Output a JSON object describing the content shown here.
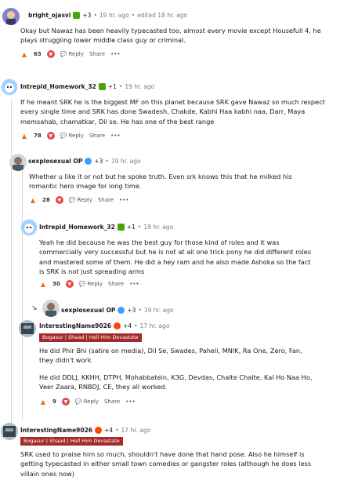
{
  "comments": [
    {
      "user": "bright_ojasvi",
      "flair_count": "+3",
      "time": "19 hr. ago",
      "edited": "edited 18 hr. ago",
      "body": "Okay but Nawaz has been heavily typecasted too, almost every movie except Housefull 4, he plays struggling lower middle class guy or criminal.",
      "score": "63",
      "reply": "Reply",
      "share": "Share",
      "more": "•••"
    },
    {
      "user": "Intrepid_Homework_32",
      "flair_count": "+1",
      "time": "19 hr. ago",
      "body": "If he meant SRK he is the biggest MF on this planet because SRK gave Nawaz so much respect every single time and SRK has done Swadesh, Chakde, Kabhi Haa kabhi naa, Darr, Maya memsahab, chamatkar, Dil se. He has one of the best range",
      "score": "78",
      "reply": "Reply",
      "share": "Share",
      "more": "•••"
    },
    {
      "user": "sexplosexual OP",
      "flair_count": "+3",
      "time": "19 hr. ago",
      "body": "Whether u like it or not but he spoke truth. Even srk knows this that he milked his romantic hero image for long time.",
      "score": "28",
      "reply": "Reply",
      "share": "Share",
      "more": "•••"
    },
    {
      "user": "Intrepid_Homework_32",
      "flair_count": "+1",
      "time": "19 hr. ago",
      "body": "Yeah he did because he was the best guy for those kind of roles and it was commercially very successful but he is not at all one trick pony he did different roles and mastered some of them. He did a hey ram and he also made Ashoka so the fact is SRK is not just spreading arms",
      "score": "30",
      "reply": "Reply",
      "share": "Share",
      "more": "•••"
    },
    {
      "user": "sexplosexual OP",
      "flair_count": "+3",
      "time": "19 hr. ago"
    },
    {
      "user": "InterestingName9026",
      "flair_count": "+4",
      "time": "17 hr. ago",
      "flair": "Bogasur | Shaad | Hell Him Devastate",
      "body1": "He did Phir Bhi (satire on media), Dil Se, Swades, Paheli, MNIK, Ra One, Zero, Fan, they didn't work",
      "body2": "He did DDLJ, KKHH, DTPH, Mohabbatein, K3G, Devdas, Chalte Chalte, Kal Ho Naa Ho, Veer Zaara, RNBDJ, CE, they all worked.",
      "score": "9",
      "reply": "Reply",
      "share": "Share",
      "more": "•••"
    },
    {
      "user": "InterestingName9026",
      "flair_count": "+4",
      "time": "17 hr. ago",
      "flair": "Bogasur | Shaad | Hell Him Devastate",
      "body": "SRK used to praise him so much, shouldn't have done that hand pose. Also he himself is getting typecasted in either small town comedies or gangster roles (although he does less villain ones now)"
    }
  ],
  "sep": "•",
  "up_icon": "upvote-icon",
  "down_icon": "downvote-icon",
  "colors": {
    "flair_bg": "#a52a2a",
    "upvote": "#ff6a00",
    "downvote": "#e84a4a",
    "award": "#46a508"
  }
}
